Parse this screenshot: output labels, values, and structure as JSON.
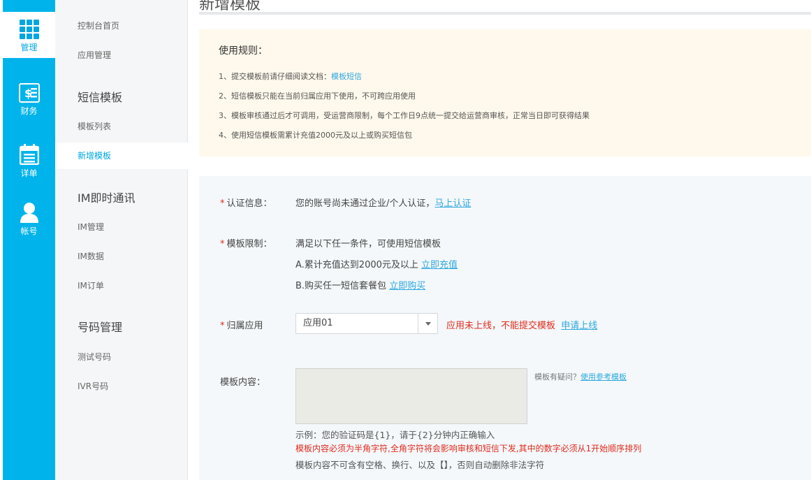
{
  "rail": {
    "items": [
      {
        "label": "管理",
        "icon": "grid-icon"
      },
      {
        "label": "财务",
        "icon": "finance-icon"
      },
      {
        "label": "详单",
        "icon": "calendar-icon"
      },
      {
        "label": "帐号",
        "icon": "user-icon"
      }
    ]
  },
  "sidebar": {
    "console_home": "控制台首页",
    "app_manage": "应用管理",
    "sms_template": "短信模板",
    "template_list": "模板列表",
    "new_template": "新增模板",
    "im": "IM即时通讯",
    "im_manage": "IM管理",
    "im_data": "IM数据",
    "im_order": "IM订单",
    "number_manage": "号码管理",
    "test_number": "测试号码",
    "ivr_number": "IVR号码"
  },
  "main": {
    "title": "新增模板",
    "rules": {
      "heading": "使用规则：",
      "r1_text": "1、提交模板前请仔细阅读文档：",
      "r1_link": "模板短信",
      "r2": "2、短信模板只能在当前归属应用下使用，不可跨应用使用",
      "r3": "3、模板审核通过后才可调用，受运营商限制，每个工作日9点统一提交给运营商审核，正常当日即可获得结果",
      "r4": "4、使用短信模板需累计充值2000元及以上或购买短信包"
    },
    "form": {
      "auth_label": "认证信息：",
      "auth_text": "您的账号尚未通过企业/个人认证，",
      "auth_link": "马上认证",
      "limit_label": "模板限制：",
      "limit_text": "满足以下任一条件，可使用短信模板",
      "limit_a": "A.累计充值达到2000元及以上",
      "limit_a_link": "立即充值",
      "limit_b": "B.购买任一短信套餐包",
      "limit_b_link": "立即购买",
      "app_label": "归属应用",
      "app_value": "应用01",
      "app_warn": "应用未上线，不能提交模板",
      "app_link": "申请上线",
      "content_label": "模板内容：",
      "hint_text": "模板有疑问？",
      "hint_link": "使用参考模板",
      "example": "示例：您的验证码是{1}，请于{2}分钟内正确输入",
      "warn_note": "模板内容必须为半角字符,全角字符将会影响审核和短信下发,其中的数字必须从1开始顺序排列",
      "note": "模板内容不可含有空格、换行、以及【】，否则自动删除非法字符"
    }
  }
}
